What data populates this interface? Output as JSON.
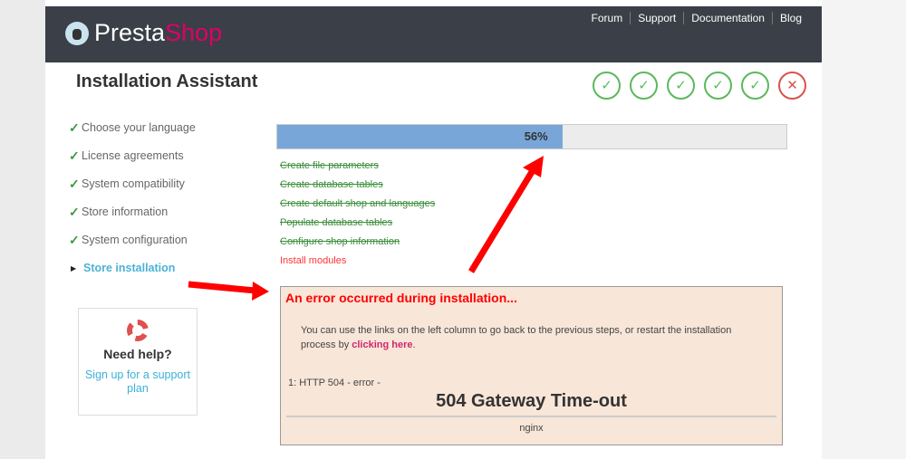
{
  "header": {
    "logo_presta": "Presta",
    "logo_shop": "Shop",
    "nav": [
      "Forum",
      "Support",
      "Documentation",
      "Blog"
    ]
  },
  "title": "Installation Assistant",
  "step_icons": [
    "check",
    "check",
    "check",
    "check",
    "check",
    "cross"
  ],
  "sidebar": {
    "items": [
      {
        "label": "Choose your language",
        "done": true
      },
      {
        "label": "License agreements",
        "done": true
      },
      {
        "label": "System compatibility",
        "done": true
      },
      {
        "label": "Store information",
        "done": true
      },
      {
        "label": "System configuration",
        "done": true
      },
      {
        "label": "Store installation",
        "done": false
      }
    ]
  },
  "help": {
    "title": "Need help?",
    "link": "Sign up for a support plan"
  },
  "progress": {
    "percent": 56,
    "label": "56%"
  },
  "tasks": [
    {
      "label": "Create file parameters",
      "status": "done"
    },
    {
      "label": "Create database tables",
      "status": "done"
    },
    {
      "label": "Create default shop and languages",
      "status": "done"
    },
    {
      "label": "Populate database tables",
      "status": "done"
    },
    {
      "label": "Configure shop information",
      "status": "done"
    },
    {
      "label": "Install modules",
      "status": "error"
    }
  ],
  "error": {
    "title": "An error occurred during installation...",
    "message": "You can use the links on the left column to go back to the previous steps, or restart the installation process by ",
    "link": "clicking here",
    "after": ".",
    "code": "1: HTTP 504 - error -",
    "heading": "504 Gateway Time-out",
    "server": "nginx"
  },
  "colors": {
    "accent": "#df0067",
    "header": "#3a3f48",
    "success": "#5cb85c",
    "error": "#d9534f"
  }
}
